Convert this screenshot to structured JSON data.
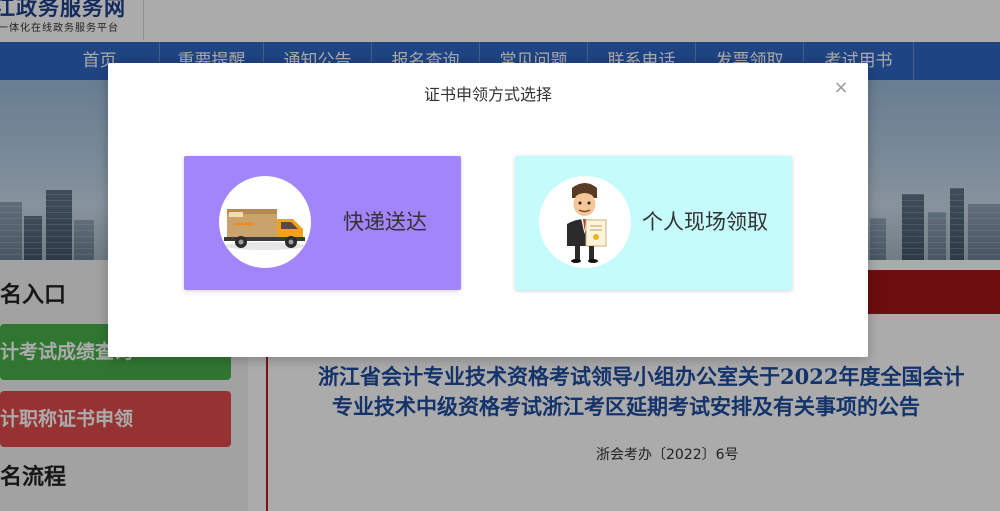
{
  "header": {
    "logo_title": "江政务服务网",
    "logo_subtitle": "一体化在线政务服务平台"
  },
  "nav": {
    "items": [
      "首页",
      "重要提醒",
      "通知公告",
      "报名查询",
      "常见问题",
      "联系电话",
      "发票领取",
      "考试用书"
    ]
  },
  "sidebar": {
    "section1_title": "名入口",
    "btn_score": "计考试成绩查询",
    "btn_certificate": "计职称证书申领",
    "section2_title": "名流程"
  },
  "notice": {
    "title_line1": "浙江省会计专业技术资格考试领导小组办公室关于2022年度全国会计",
    "title_line2": "专业技术中级资格考试浙江考区延期考试安排及有关事项的公告",
    "doc_number": "浙会考办〔2022〕6号"
  },
  "modal": {
    "title": "证书申领方式选择",
    "close": "×",
    "options": [
      {
        "label": "快递送达",
        "icon": "delivery-truck-icon",
        "color": "#a385fb"
      },
      {
        "label": "个人现场领取",
        "icon": "person-certificate-icon",
        "color": "#c6fbfb"
      }
    ]
  },
  "colors": {
    "nav": "#2f66c4",
    "green_button": "#48b14a",
    "red_button": "#e14b4b",
    "notice_title": "#1f4da0"
  }
}
